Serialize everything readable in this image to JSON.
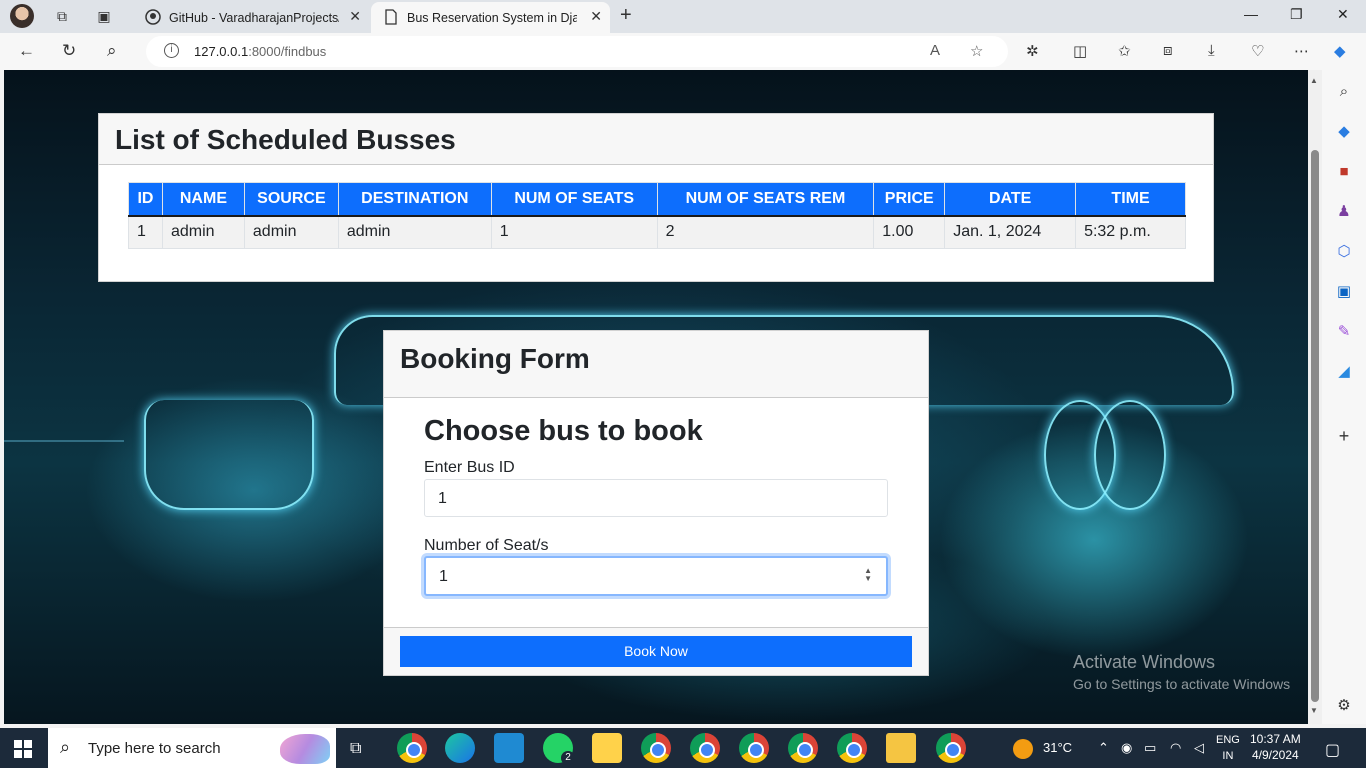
{
  "browser": {
    "tabs": [
      {
        "title": "GitHub - VaradharajanProjects/N",
        "close": "✕"
      },
      {
        "title": "Bus Reservation System in Djang",
        "close": "✕"
      }
    ],
    "new_tab": "+",
    "url_host": "127.0.0.1",
    "url_rest": ":8000/findbus",
    "window_controls": {
      "minimize": "—",
      "maximize": "❐",
      "close": "✕"
    }
  },
  "page": {
    "list_title": "List of Scheduled Busses",
    "table": {
      "headers": [
        "ID",
        "NAME",
        "SOURCE",
        "DESTINATION",
        "NUM OF SEATS",
        "NUM OF SEATS REM",
        "PRICE",
        "DATE",
        "TIME"
      ],
      "rows": [
        [
          "1",
          "admin",
          "admin",
          "admin",
          "1",
          "2",
          "1.00",
          "Jan. 1, 2024",
          "5:32 p.m."
        ]
      ]
    },
    "booking": {
      "header": "Booking Form",
      "title": "Choose bus to book",
      "bus_id_label": "Enter Bus ID",
      "bus_id_value": "1",
      "seats_label": "Number of Seat/s",
      "seats_value": "1",
      "submit_label": "Book Now"
    }
  },
  "watermark": {
    "line1": "Activate Windows",
    "line2": "Go to Settings to activate Windows"
  },
  "taskbar": {
    "search_placeholder": "Type here to search",
    "whatsapp_badge": "2",
    "temperature": "31°C",
    "language": "ENG",
    "region": "IN",
    "time": "10:37 AM",
    "date": "4/9/2024"
  },
  "colors": {
    "primary": "#0d6efd",
    "card_header": "#f7f7f7",
    "table_cell": "#f2f2f2"
  }
}
